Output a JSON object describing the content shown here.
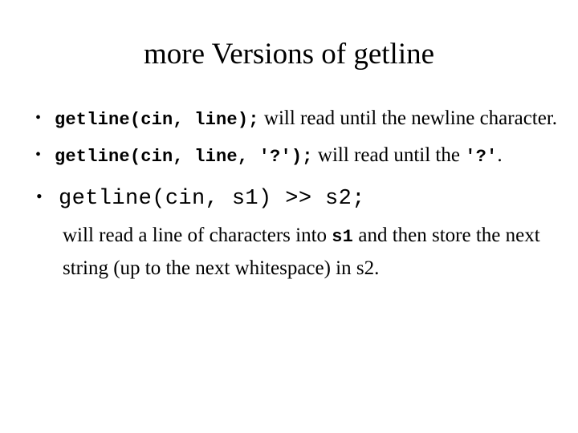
{
  "slide": {
    "title": "more Versions of getline",
    "background_color": "#ffffff",
    "text_color": "#000000",
    "bullet_glyph": "•",
    "bullets": [
      {
        "marker": "•",
        "code": "getline(cin, line);",
        "text_after": " will read until the newline character."
      },
      {
        "marker": "•",
        "code": "getline(cin, line, '?');",
        "text_after": " will read until the ",
        "code_tail": "'?'",
        "text_tail": "."
      },
      {
        "marker": "•",
        "code": "getline(cin, s1) >> s2;",
        "explanation_part1": "will read a line of characters into ",
        "explanation_code": "s1",
        "explanation_part2": " and then store the next string (up to the next whitespace) in s2."
      }
    ]
  }
}
